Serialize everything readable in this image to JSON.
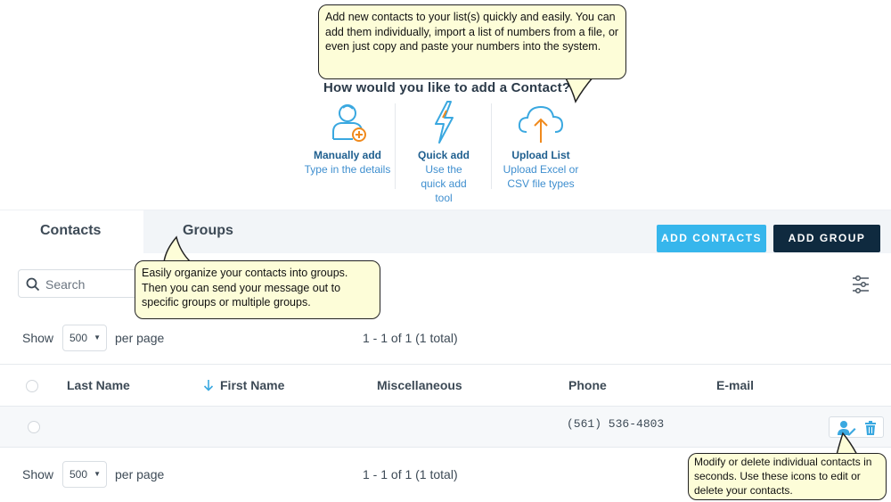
{
  "chooser": {
    "title": "How would you like to add a Contact?",
    "options": [
      {
        "title": "Manually add",
        "desc": "Type in the details",
        "icon": "person-add-icon"
      },
      {
        "title": "Quick add",
        "desc": "Use the quick add tool",
        "icon": "lightning-icon"
      },
      {
        "title": "Upload List",
        "desc": "Upload Excel or CSV file types",
        "icon": "cloud-upload-icon"
      }
    ]
  },
  "callouts": {
    "add_contacts": "Add new contacts to your list(s) quickly and easily. You can add them individually, import a list of numbers from a file, or even just copy and paste your numbers into the system.",
    "groups": "Easily organize your contacts into groups. Then you can send your message out to specific groups or multiple groups.",
    "row_actions": "Modify or delete individual contacts in seconds. Use these icons to edit or delete your contacts."
  },
  "tabs": [
    {
      "label": "Contacts",
      "active": true
    },
    {
      "label": "Groups",
      "active": false
    }
  ],
  "buttons": {
    "add_contacts": "ADD CONTACTS",
    "add_group": "ADD GROUP"
  },
  "search": {
    "placeholder": "Search"
  },
  "pager": {
    "show_label": "Show",
    "page_size": "500",
    "per_page_label": "per page",
    "summary": "1 - 1 of 1 (1 total)"
  },
  "table": {
    "columns": [
      "Last Name",
      "First Name",
      "Miscellaneous",
      "Phone",
      "E-mail"
    ],
    "sort_column": "First Name",
    "rows": [
      {
        "last_name": "",
        "first_name": "",
        "misc": "",
        "phone": "(561) 536-4803",
        "email": ""
      }
    ]
  },
  "colors": {
    "accent": "#36b6ec",
    "dark_button": "#0f2a3f",
    "callout_bg": "#fdfdd8",
    "icon_orange": "#f08a1d",
    "icon_blue": "#3aa8e0"
  }
}
